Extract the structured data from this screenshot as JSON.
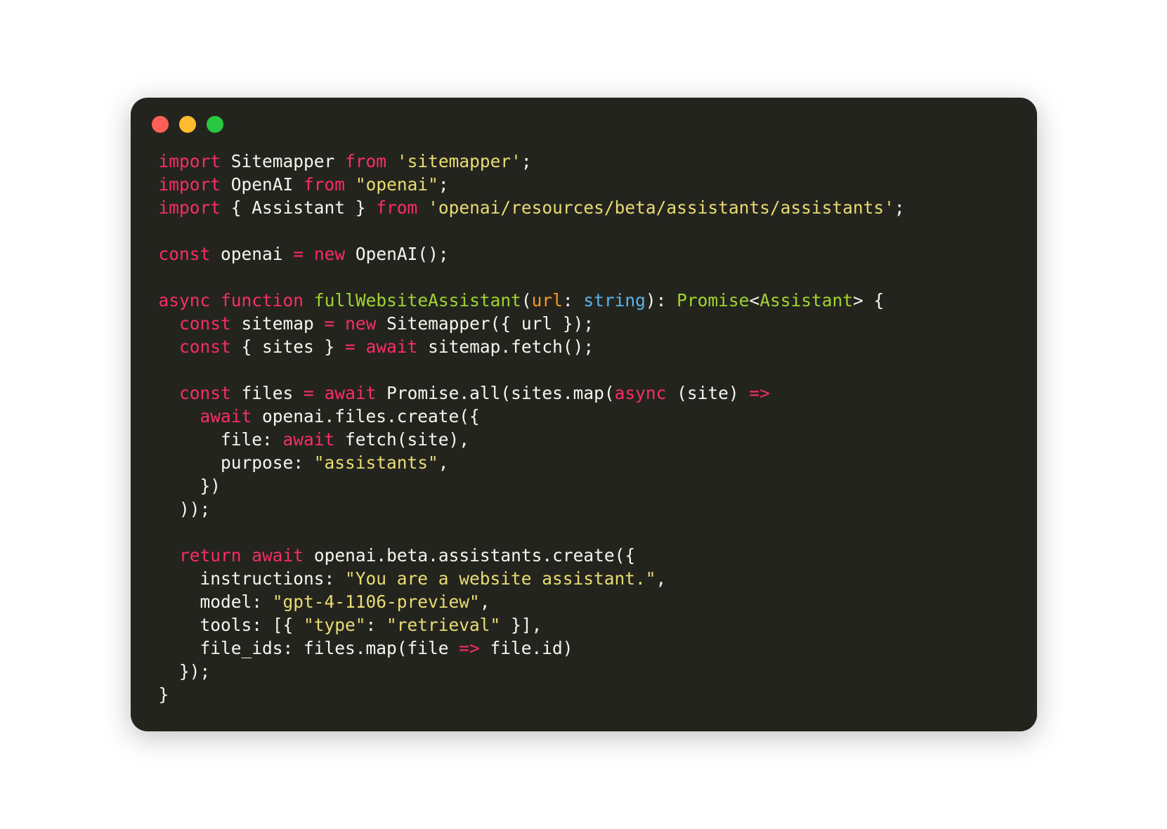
{
  "traffic": {
    "red": "#ff5f57",
    "yellow": "#febc2e",
    "green": "#28c840"
  },
  "theme": {
    "bg": "#24241f",
    "fg": "#f6f6f0",
    "pink": "#f72d67",
    "green": "#a0d52c",
    "orange": "#f8991e",
    "yellow": "#e9dc71",
    "blue": "#56b5ee"
  },
  "code": {
    "language": "typescript",
    "tokens": [
      [
        {
          "t": "import",
          "c": "kw"
        },
        {
          "t": " Sitemapper "
        },
        {
          "t": "from",
          "c": "kw"
        },
        {
          "t": " "
        },
        {
          "t": "'sitemapper'",
          "c": "str"
        },
        {
          "t": ";"
        }
      ],
      [
        {
          "t": "import",
          "c": "kw"
        },
        {
          "t": " OpenAI "
        },
        {
          "t": "from",
          "c": "kw"
        },
        {
          "t": " "
        },
        {
          "t": "\"openai\"",
          "c": "str"
        },
        {
          "t": ";"
        }
      ],
      [
        {
          "t": "import",
          "c": "kw"
        },
        {
          "t": " { Assistant } "
        },
        {
          "t": "from",
          "c": "kw"
        },
        {
          "t": " "
        },
        {
          "t": "'openai/resources/beta/assistants/assistants'",
          "c": "str"
        },
        {
          "t": ";"
        }
      ],
      [],
      [
        {
          "t": "const",
          "c": "kw"
        },
        {
          "t": " openai "
        },
        {
          "t": "=",
          "c": "kw"
        },
        {
          "t": " "
        },
        {
          "t": "new",
          "c": "kw"
        },
        {
          "t": " OpenAI();"
        }
      ],
      [],
      [
        {
          "t": "async",
          "c": "kw"
        },
        {
          "t": " "
        },
        {
          "t": "function",
          "c": "kw"
        },
        {
          "t": " "
        },
        {
          "t": "fullWebsiteAssistant",
          "c": "fn"
        },
        {
          "t": "("
        },
        {
          "t": "url",
          "c": "param"
        },
        {
          "t": ": "
        },
        {
          "t": "string",
          "c": "type"
        },
        {
          "t": "): "
        },
        {
          "t": "Promise",
          "c": "fn"
        },
        {
          "t": "<"
        },
        {
          "t": "Assistant",
          "c": "fn"
        },
        {
          "t": "> {"
        }
      ],
      [
        {
          "t": "  "
        },
        {
          "t": "const",
          "c": "kw"
        },
        {
          "t": " sitemap "
        },
        {
          "t": "=",
          "c": "kw"
        },
        {
          "t": " "
        },
        {
          "t": "new",
          "c": "kw"
        },
        {
          "t": " Sitemapper({ url });"
        }
      ],
      [
        {
          "t": "  "
        },
        {
          "t": "const",
          "c": "kw"
        },
        {
          "t": " { sites } "
        },
        {
          "t": "=",
          "c": "kw"
        },
        {
          "t": " "
        },
        {
          "t": "await",
          "c": "kw"
        },
        {
          "t": " sitemap.fetch();"
        }
      ],
      [],
      [
        {
          "t": "  "
        },
        {
          "t": "const",
          "c": "kw"
        },
        {
          "t": " files "
        },
        {
          "t": "=",
          "c": "kw"
        },
        {
          "t": " "
        },
        {
          "t": "await",
          "c": "kw"
        },
        {
          "t": " Promise.all(sites.map("
        },
        {
          "t": "async",
          "c": "kw"
        },
        {
          "t": " (site) "
        },
        {
          "t": "=>",
          "c": "kw"
        }
      ],
      [
        {
          "t": "    "
        },
        {
          "t": "await",
          "c": "kw"
        },
        {
          "t": " openai.files.create({"
        }
      ],
      [
        {
          "t": "      file: "
        },
        {
          "t": "await",
          "c": "kw"
        },
        {
          "t": " fetch(site),"
        }
      ],
      [
        {
          "t": "      purpose: "
        },
        {
          "t": "\"assistants\"",
          "c": "str"
        },
        {
          "t": ","
        }
      ],
      [
        {
          "t": "    })"
        }
      ],
      [
        {
          "t": "  ));"
        }
      ],
      [],
      [
        {
          "t": "  "
        },
        {
          "t": "return",
          "c": "kw"
        },
        {
          "t": " "
        },
        {
          "t": "await",
          "c": "kw"
        },
        {
          "t": " openai.beta.assistants.create({"
        }
      ],
      [
        {
          "t": "    instructions: "
        },
        {
          "t": "\"You are a website assistant.\"",
          "c": "str"
        },
        {
          "t": ","
        }
      ],
      [
        {
          "t": "    model: "
        },
        {
          "t": "\"gpt-4-1106-preview\"",
          "c": "str"
        },
        {
          "t": ","
        }
      ],
      [
        {
          "t": "    tools: [{ "
        },
        {
          "t": "\"type\"",
          "c": "str"
        },
        {
          "t": ": "
        },
        {
          "t": "\"retrieval\"",
          "c": "str"
        },
        {
          "t": " }],"
        }
      ],
      [
        {
          "t": "    file_ids: files.map(file "
        },
        {
          "t": "=>",
          "c": "kw"
        },
        {
          "t": " file.id)"
        }
      ],
      [
        {
          "t": "  });"
        }
      ],
      [
        {
          "t": "}"
        }
      ]
    ]
  }
}
